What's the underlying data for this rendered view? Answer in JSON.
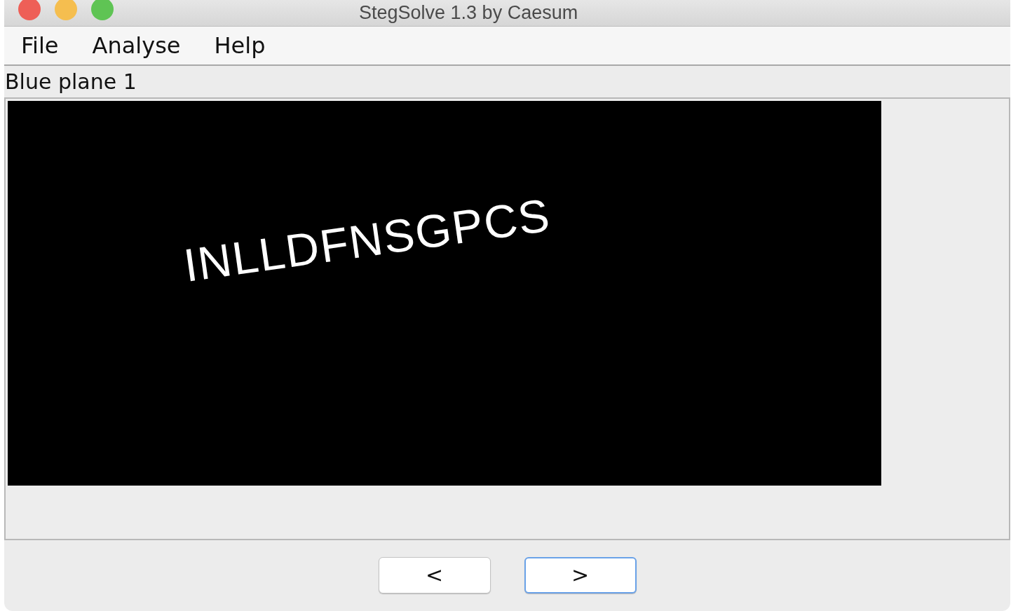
{
  "window": {
    "title": "StegSolve 1.3 by Caesum"
  },
  "menu": [
    {
      "label": "File"
    },
    {
      "label": "Analyse"
    },
    {
      "label": "Help"
    }
  ],
  "plane_label": "Blue plane 1",
  "image": {
    "text": "INLLDFNSGPCS"
  },
  "buttons": [
    {
      "label": "<",
      "focused": false
    },
    {
      "label": ">",
      "focused": true
    }
  ]
}
